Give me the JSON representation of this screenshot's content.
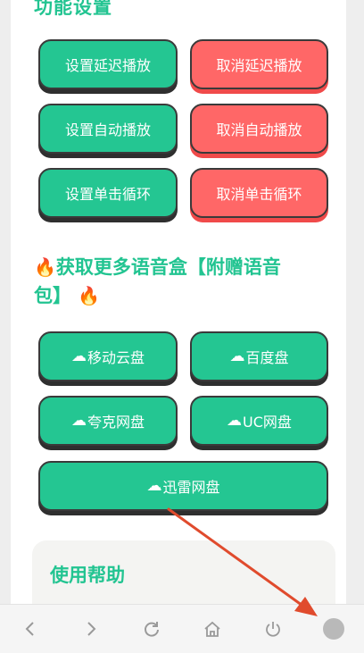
{
  "section_title": "功能设置",
  "buttons": {
    "set_delay": "设置延迟播放",
    "cancel_delay": "取消延迟播放",
    "set_auto": "设置自动播放",
    "cancel_auto": "取消自动播放",
    "set_loop": "设置单击循环",
    "cancel_loop": "取消单击循环"
  },
  "promo": {
    "line1": "获取更多语音盒【附赠语音",
    "line2": "包】"
  },
  "disks": {
    "yidong": "移动云盘",
    "baidu": "百度盘",
    "kuake": "夸克网盘",
    "uc": "UC网盘",
    "xunlei": "迅雷网盘"
  },
  "help": {
    "title": "使用帮助"
  },
  "icons": {
    "fire": "fire-icon",
    "cloud": "cloud-icon"
  },
  "colors": {
    "accent": "#24c692",
    "danger": "#ff6767",
    "annotation": "#e04b2d"
  }
}
